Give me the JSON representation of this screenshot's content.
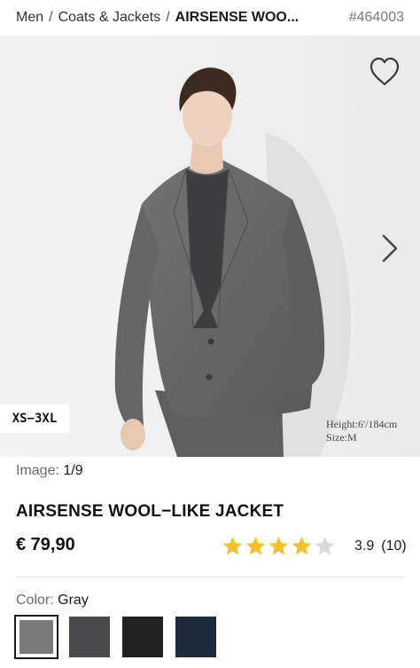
{
  "breadcrumb": {
    "items": [
      "Men",
      "Coats & Jackets",
      "AIRSENSE WOO..."
    ],
    "separator": "/",
    "product_id": "#464003"
  },
  "hero": {
    "size_badge": "XS−3XL",
    "model_height": "Height:6'/184cm",
    "model_size": "Size:M",
    "favorite_icon": "heart-outline-icon",
    "next_icon": "chevron-right-icon"
  },
  "image_counter": {
    "label": "Image:",
    "value": "1/9"
  },
  "product": {
    "title": "AIRSENSE WOOL−LIKE JACKET",
    "price": "€ 79,90",
    "rating_value": "3.9",
    "rating_count": "(10)",
    "rating_stars": 3.9,
    "star_color": "#f2c12e",
    "star_empty_color": "#d9d9d9"
  },
  "color": {
    "label": "Color:",
    "selected": "Gray",
    "swatches": [
      {
        "name": "Gray",
        "hex": "#7a7a7a",
        "selected": true
      },
      {
        "name": "Dark Gray",
        "hex": "#4a4a4c",
        "selected": false
      },
      {
        "name": "Black",
        "hex": "#222222",
        "selected": false
      },
      {
        "name": "Navy",
        "hex": "#1f2a3b",
        "selected": false
      }
    ]
  }
}
